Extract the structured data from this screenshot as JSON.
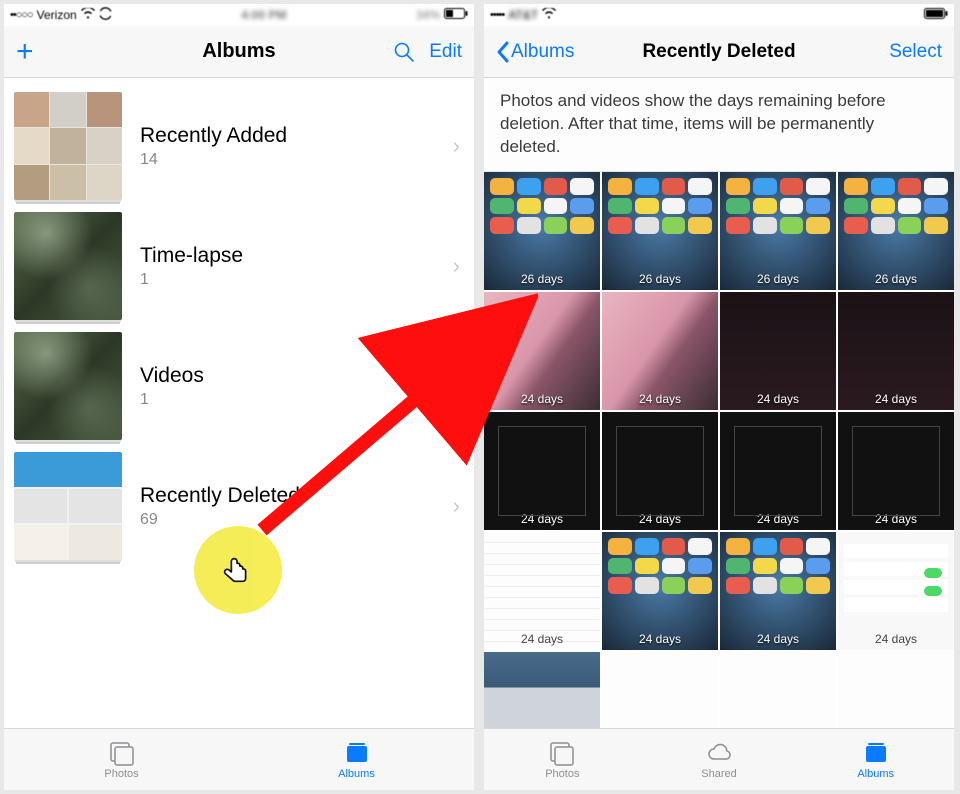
{
  "left": {
    "status": {
      "carrier": "Verizon",
      "signal": "••○○○",
      "time": "4:00 PM",
      "battery": "34%"
    },
    "nav": {
      "title": "Albums",
      "edit": "Edit"
    },
    "albums": [
      {
        "title": "Recently Added",
        "count": "14"
      },
      {
        "title": "Time-lapse",
        "count": "1"
      },
      {
        "title": "Videos",
        "count": "1"
      },
      {
        "title": "Recently Deleted",
        "count": "69"
      }
    ],
    "tabs": {
      "photos": "Photos",
      "albums": "Albums"
    }
  },
  "right": {
    "status": {
      "carrier": "AT&T",
      "signal": "•••••",
      "time": "",
      "battery": ""
    },
    "nav": {
      "back": "Albums",
      "title": "Recently Deleted",
      "select": "Select"
    },
    "info": "Photos and videos show the days remaining before deletion. After that time, items will be permanently deleted.",
    "cells": [
      {
        "days": "26 days"
      },
      {
        "days": "26 days"
      },
      {
        "days": "26 days"
      },
      {
        "days": "26 days"
      },
      {
        "days": "24 days"
      },
      {
        "days": "24 days"
      },
      {
        "days": "24 days"
      },
      {
        "days": "24 days"
      },
      {
        "days": "24 days"
      },
      {
        "days": "24 days"
      },
      {
        "days": "24 days"
      },
      {
        "days": "24 days"
      },
      {
        "days": "24 days"
      },
      {
        "days": "24 days"
      },
      {
        "days": "24 days"
      },
      {
        "days": "24 days"
      },
      {
        "days": ""
      },
      {
        "days": ""
      },
      {
        "days": ""
      },
      {
        "days": ""
      }
    ],
    "tabs": {
      "photos": "Photos",
      "shared": "Shared",
      "albums": "Albums"
    }
  }
}
